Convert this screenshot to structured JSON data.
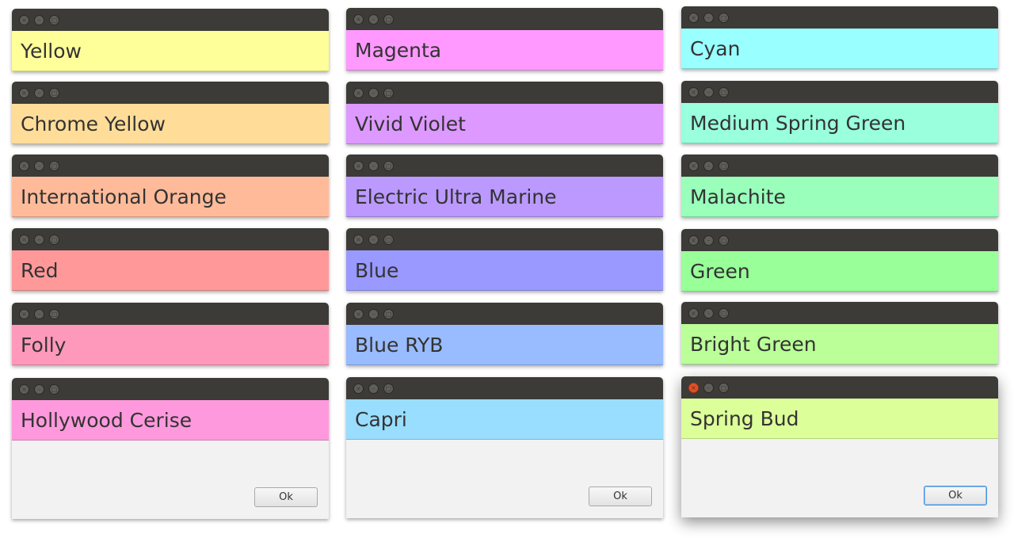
{
  "columns": [
    {
      "windows": [
        {
          "label": "Yellow",
          "color": "#ffff99"
        },
        {
          "label": "Chrome Yellow",
          "color": "#ffdd99"
        },
        {
          "label": "International Orange",
          "color": "#ffbb99"
        },
        {
          "label": "Red",
          "color": "#ff9999"
        },
        {
          "label": "Folly",
          "color": "#ff99bb"
        },
        {
          "label": "Hollywood Cerise",
          "color": "#ff99dd"
        }
      ],
      "ok_label": "Ok"
    },
    {
      "windows": [
        {
          "label": "Magenta",
          "color": "#ff99ff"
        },
        {
          "label": "Vivid Violet",
          "color": "#dd99ff"
        },
        {
          "label": "Electric Ultra Marine",
          "color": "#bb99ff"
        },
        {
          "label": "Blue",
          "color": "#9999ff"
        },
        {
          "label": "Blue RYB",
          "color": "#99bbff"
        },
        {
          "label": "Capri",
          "color": "#99ddff"
        }
      ],
      "ok_label": "Ok"
    },
    {
      "windows": [
        {
          "label": "Cyan",
          "color": "#99ffff"
        },
        {
          "label": "Medium Spring Green",
          "color": "#99ffdd"
        },
        {
          "label": "Malachite",
          "color": "#99ffbb"
        },
        {
          "label": "Green",
          "color": "#99ff99"
        },
        {
          "label": "Bright Green",
          "color": "#bbff99"
        },
        {
          "label": "Spring Bud",
          "color": "#ddff99"
        }
      ],
      "ok_label": "Ok"
    }
  ],
  "titlebar_buttons": [
    "close-icon",
    "minimize-icon",
    "maximize-icon"
  ],
  "titlebar_glyphs": {
    "close": "×",
    "minimize": "–",
    "maximize": "□"
  }
}
